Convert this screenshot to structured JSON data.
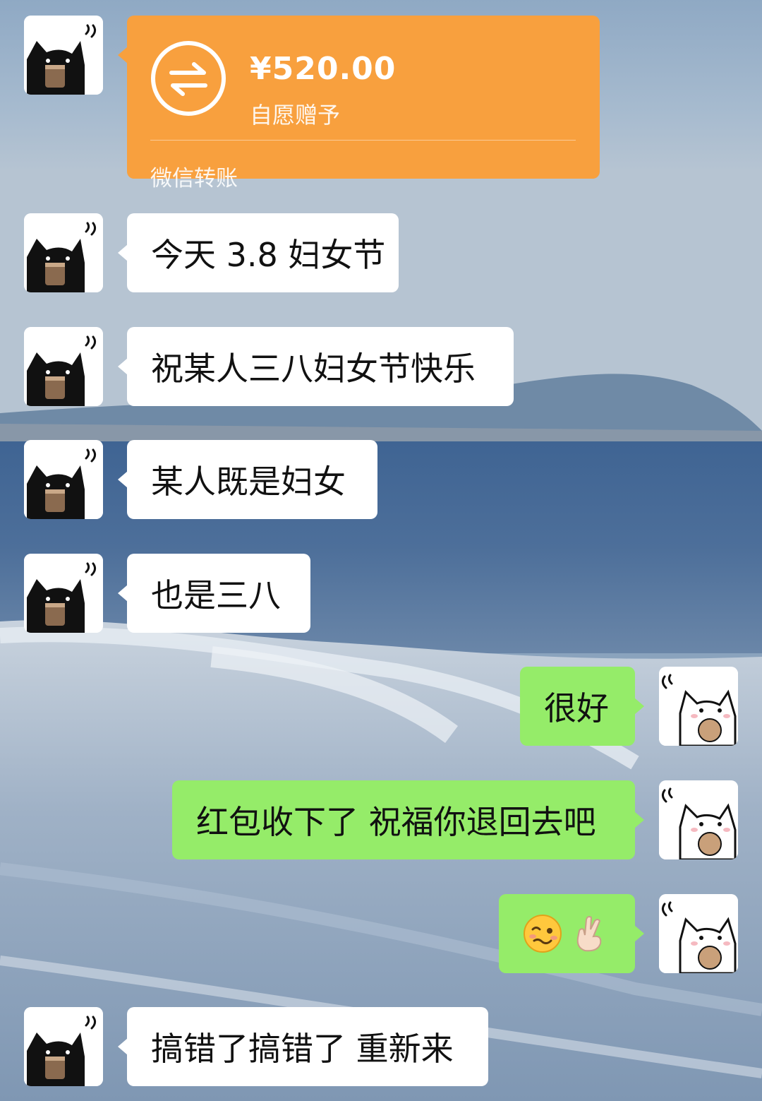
{
  "transfer": {
    "amount": "¥520.00",
    "note": "自愿赠予",
    "footer": "微信转账"
  },
  "messages": [
    {
      "side": "left",
      "text": "今天 3.8 妇女节"
    },
    {
      "side": "left",
      "text": "祝某人三八妇女节快乐"
    },
    {
      "side": "left",
      "text": "某人既是妇女"
    },
    {
      "side": "left",
      "text": "也是三八"
    },
    {
      "side": "right",
      "text": "很好"
    },
    {
      "side": "right",
      "text": "红包收下了 祝福你退回去吧"
    },
    {
      "side": "right",
      "emoji": [
        "woozy-face-icon",
        "crossed-fingers-icon"
      ]
    },
    {
      "side": "left",
      "text": "搞错了搞错了 重新来"
    }
  ],
  "colors": {
    "transfer_orange": "#f8a03e",
    "own_bubble_green": "#95ec69",
    "other_bubble_white": "#ffffff"
  }
}
